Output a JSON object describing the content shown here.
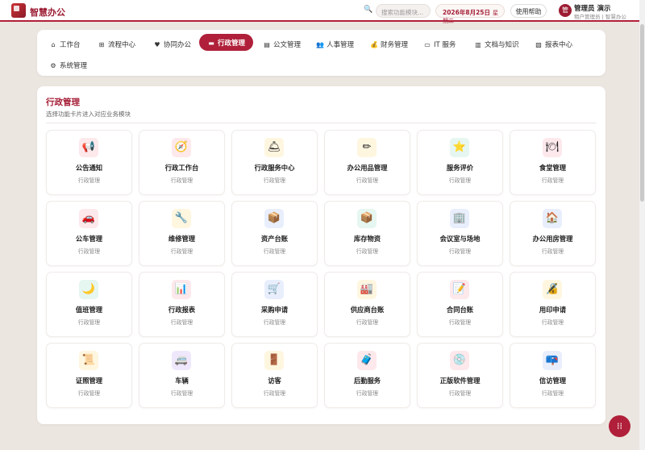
{
  "app": {
    "title": "智慧办公"
  },
  "header": {
    "search_placeholder": "搜索功能模块...",
    "date": "2026年8月25日",
    "weekday": "星期二",
    "help_label": "使用帮助",
    "user_name": "管理员 演示",
    "user_role": "租户管理员 | 智慧办公",
    "avatar_char": "管"
  },
  "nav": {
    "items": [
      {
        "label": "工作台",
        "icon": "home-icon",
        "glyph": "⌂"
      },
      {
        "label": "流程中心",
        "icon": "flow-icon",
        "glyph": "⊞"
      },
      {
        "label": "协同办公",
        "icon": "heart-icon",
        "glyph": "♥"
      },
      {
        "label": "行政管理",
        "icon": "admin-icon",
        "glyph": "▬",
        "active": true
      },
      {
        "label": "公文管理",
        "icon": "document-icon",
        "glyph": "▤"
      },
      {
        "label": "人事管理",
        "icon": "people-icon",
        "glyph": "👥"
      },
      {
        "label": "财务管理",
        "icon": "money-bag-icon",
        "glyph": "💰"
      },
      {
        "label": "IT 服务",
        "icon": "computer-icon",
        "glyph": "▭"
      },
      {
        "label": "文档与知识",
        "icon": "book-icon",
        "glyph": "▥"
      },
      {
        "label": "报表中心",
        "icon": "report-icon",
        "glyph": "▧"
      },
      {
        "label": "系统管理",
        "icon": "gear-icon",
        "glyph": "⚙"
      }
    ]
  },
  "main": {
    "title": "行政管理",
    "subtitle": "选择功能卡片进入对应业务模块",
    "category": "行政管理",
    "tiles": [
      {
        "name": "公告通知",
        "icon": "megaphone-icon",
        "glyph": "📢",
        "bg": "#fde8ec"
      },
      {
        "name": "行政工作台",
        "icon": "compass-icon",
        "glyph": "🧭",
        "bg": "#fde8ec"
      },
      {
        "name": "行政服务中心",
        "icon": "bell-icon",
        "glyph": "🛎",
        "bg": "#fff6e0"
      },
      {
        "name": "办公用品管理",
        "icon": "pencil-icon",
        "glyph": "✏",
        "bg": "#fff6e0"
      },
      {
        "name": "服务评价",
        "icon": "star-icon",
        "glyph": "⭐",
        "bg": "#e6f6f1"
      },
      {
        "name": "食堂管理",
        "icon": "dining-icon",
        "glyph": "🍽",
        "bg": "#fde8ec"
      },
      {
        "name": "公车管理",
        "icon": "car-icon",
        "glyph": "🚗",
        "bg": "#fde8ec"
      },
      {
        "name": "维修管理",
        "icon": "wrench-icon",
        "glyph": "🔧",
        "bg": "#fff6e0"
      },
      {
        "name": "资产台账",
        "icon": "box-icon",
        "glyph": "📦",
        "bg": "#e8eefc"
      },
      {
        "name": "库存物资",
        "icon": "package-icon",
        "glyph": "📦",
        "bg": "#e6f6f1"
      },
      {
        "name": "会议室与场地",
        "icon": "building-icon",
        "glyph": "🏢",
        "bg": "#e8eefc"
      },
      {
        "name": "办公用房管理",
        "icon": "house-icon",
        "glyph": "🏠",
        "bg": "#e8eefc"
      },
      {
        "name": "值班管理",
        "icon": "moon-icon",
        "glyph": "🌙",
        "bg": "#e6f6f1"
      },
      {
        "name": "行政报表",
        "icon": "bar-chart-icon",
        "glyph": "📊",
        "bg": "#fde8ec"
      },
      {
        "name": "采购申请",
        "icon": "cart-icon",
        "glyph": "🛒",
        "bg": "#e8eefc"
      },
      {
        "name": "供应商台账",
        "icon": "factory-icon",
        "glyph": "🏭",
        "bg": "#fff6e0"
      },
      {
        "name": "合同台账",
        "icon": "contract-icon",
        "glyph": "📝",
        "bg": "#fde8ec"
      },
      {
        "name": "用印申请",
        "icon": "lock-icon",
        "glyph": "🔏",
        "bg": "#fff6e0"
      },
      {
        "name": "证照管理",
        "icon": "certificate-icon",
        "glyph": "📜",
        "bg": "#fff6e0"
      },
      {
        "name": "车辆",
        "icon": "van-icon",
        "glyph": "🚐",
        "bg": "#efe8fc"
      },
      {
        "name": "访客",
        "icon": "door-icon",
        "glyph": "🚪",
        "bg": "#fff6e0"
      },
      {
        "name": "后勤服务",
        "icon": "luggage-icon",
        "glyph": "🧳",
        "bg": "#fde8ec"
      },
      {
        "name": "正版软件管理",
        "icon": "disc-icon",
        "glyph": "💿",
        "bg": "#fde8ec"
      },
      {
        "name": "信访管理",
        "icon": "mailbox-icon",
        "glyph": "📪",
        "bg": "#e8eefc"
      }
    ]
  },
  "fab": {
    "icon": "grid-icon",
    "glyph": "⁞⁞"
  },
  "colors": {
    "brand": "#b0203a",
    "background": "#ece6e0"
  }
}
